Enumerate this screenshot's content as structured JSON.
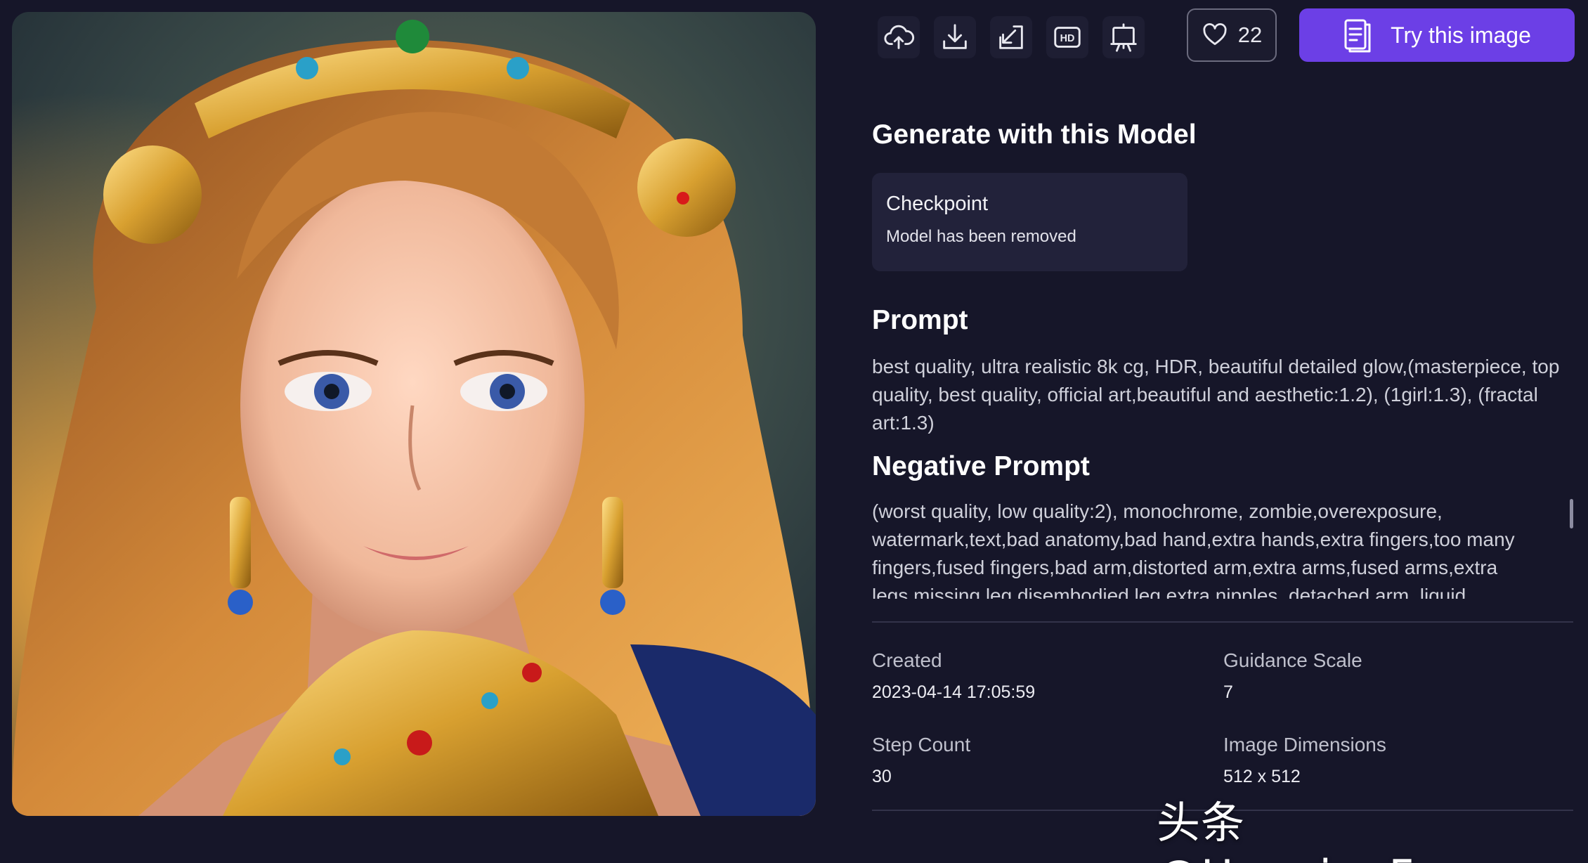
{
  "toolbar": {
    "icons": [
      "cloud-upload-icon",
      "download-icon",
      "import-icon",
      "hd-icon",
      "easel-icon"
    ],
    "like_count": "22",
    "try_label": "Try this image"
  },
  "sections": {
    "model_heading": "Generate with this Model",
    "prompt_heading": "Prompt",
    "negative_heading": "Negative Prompt"
  },
  "model": {
    "type": "Checkpoint",
    "status": "Model has been removed"
  },
  "prompt": "best quality, ultra realistic 8k cg, HDR, beautiful detailed glow,(masterpiece, top quality, best quality, official art,beautiful and aesthetic:1.2), (1girl:1.3), (fractal art:1.3)",
  "negative_prompt": "(worst quality, low quality:2), monochrome, zombie,overexposure, watermark,text,bad anatomy,bad hand,extra hands,extra fingers,too many fingers,fused fingers,bad arm,distorted arm,extra arms,fused arms,extra legs,missing leg,disembodied leg,extra nipples, detached arm, liquid",
  "meta": {
    "created_label": "Created",
    "created_value": "2023-04-14 17:05:59",
    "guidance_label": "Guidance Scale",
    "guidance_value": "7",
    "steps_label": "Step Count",
    "steps_value": "30",
    "dimensions_label": "Image Dimensions",
    "dimensions_value": "512 x 512"
  },
  "watermark": "头条 @HuggingFace",
  "colors": {
    "background": "#161629",
    "accent": "#6c3fe6",
    "card": "#22223a"
  }
}
